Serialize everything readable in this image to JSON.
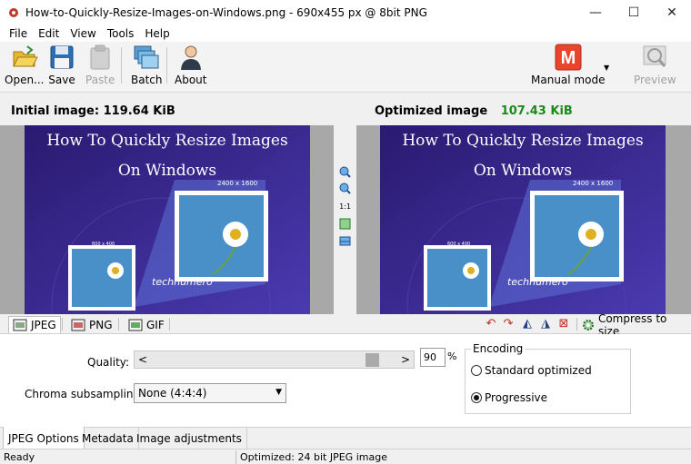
{
  "window": {
    "title": "How-to-Quickly-Resize-Images-on-Windows.png - 690x455 px @ 8bit PNG",
    "minimize": "—",
    "maximize": "☐",
    "close": "✕"
  },
  "menu": [
    "File",
    "Edit",
    "View",
    "Tools",
    "Help"
  ],
  "toolbar": {
    "open": "Open...",
    "save": "Save",
    "paste": "Paste",
    "batch": "Batch",
    "about": "About",
    "mode": "Manual mode",
    "mode_badge": "M",
    "preview": "Preview"
  },
  "sizes": {
    "initial_label": "Initial image:",
    "initial_value": "119.64 KiB",
    "optimized_label": "Optimized image",
    "optimized_value": "107.43 KiB"
  },
  "image": {
    "title_line1": "How To Quickly Resize Images",
    "title_line2": "On Windows",
    "size_big": "2400 x 1600",
    "size_small": "600 x 400",
    "brand": "technumero"
  },
  "zoom": {
    "one_to_one": "1:1"
  },
  "formats": {
    "jpeg": "JPEG",
    "png": "PNG",
    "gif": "GIF",
    "compress": "Compress to size"
  },
  "options": {
    "quality_label": "Quality:",
    "quality_value": "90",
    "quality_unit": "%",
    "quality_fraction": 0.9,
    "chroma_label": "Chroma subsampling:",
    "chroma_value": "None (4:4:4)",
    "encoding_title": "Encoding",
    "enc_standard": "Standard optimized",
    "enc_progressive": "Progressive",
    "selected_encoding": "Progressive"
  },
  "tabs": [
    "JPEG Options",
    "Metadata",
    "Image adjustments"
  ],
  "status": {
    "left": "Ready",
    "right": "Optimized: 24 bit JPEG image"
  },
  "colors": {
    "accent_green": "#1a8a1a",
    "mode_red": "#e8452c",
    "image_purple": "#3a2a8a"
  }
}
